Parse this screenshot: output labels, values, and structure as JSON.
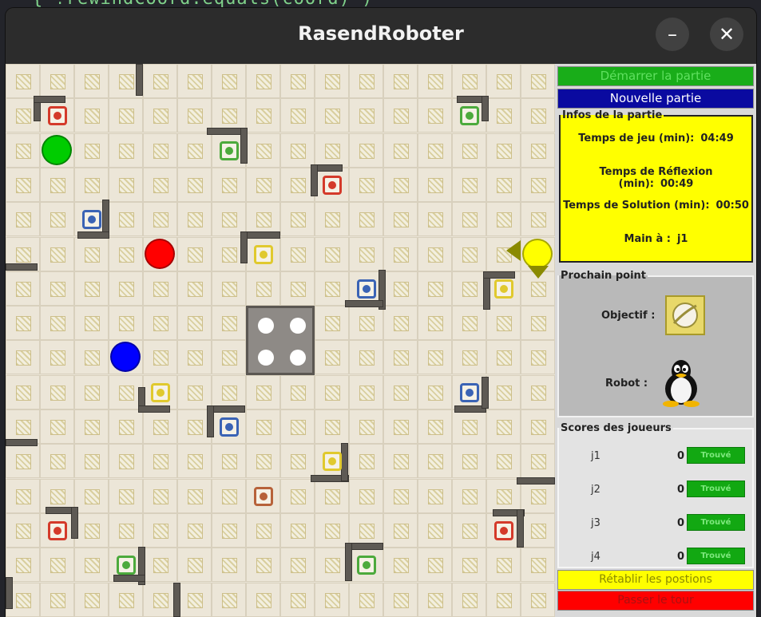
{
  "window": {
    "title": "RasendRoboter",
    "minimize_label": "–",
    "close_label": "✕"
  },
  "background_code": "{ !rewindCoord.equals(coord) ) ",
  "sidebar": {
    "start_label": "Démarrer la partie",
    "new_game_label": "Nouvelle partie",
    "infos": {
      "legend": "Infos de la partie",
      "rows": [
        {
          "label": "Temps de jeu (min):",
          "value": "04:49"
        },
        {
          "label": "Temps de Réflexion (min):",
          "value": "00:49"
        },
        {
          "label": "Temps de Solution (min):",
          "value": "00:50"
        },
        {
          "label": "Main à :",
          "value": "j1"
        }
      ]
    },
    "next_point": {
      "legend": "Prochain point",
      "objective_label": "Objectif :",
      "robot_label": "Robot :",
      "objective_icon": "yellow-planet-icon",
      "robot_icon": "penguin-icon"
    },
    "scores": {
      "legend": "Scores des joueurs",
      "players": [
        {
          "name": "j1",
          "score": "0",
          "button": "Trouvé"
        },
        {
          "name": "j2",
          "score": "0",
          "button": "Trouvé"
        },
        {
          "name": "j3",
          "score": "0",
          "button": "Trouvé"
        },
        {
          "name": "j4",
          "score": "0",
          "button": "Trouvé"
        }
      ]
    },
    "reset_label": "Rétablir les postions",
    "pass_label": "Passer le tour"
  },
  "board": {
    "rows": 16,
    "cols": 16,
    "robots": [
      {
        "color": "#00cc00",
        "row": 2,
        "col": 1
      },
      {
        "color": "#ff0000",
        "row": 5,
        "col": 4
      },
      {
        "color": "#0000ff",
        "row": 8,
        "col": 3
      },
      {
        "color": "#ffff00",
        "row": 5,
        "col": 15
      }
    ],
    "targets": [
      {
        "name": "red-triangle-target",
        "row": 1,
        "col": 1,
        "color": "#d43a2a"
      },
      {
        "name": "green-triangle-target",
        "row": 1,
        "col": 13,
        "color": "#4caa3c"
      },
      {
        "name": "green-planet-target",
        "row": 2,
        "col": 6,
        "color": "#4caa3c"
      },
      {
        "name": "red-planet-target",
        "row": 3,
        "col": 9,
        "color": "#d43a2a"
      },
      {
        "name": "blue-cross-target",
        "row": 4,
        "col": 2,
        "color": "#3a63b5"
      },
      {
        "name": "yellow-planet-target",
        "row": 5,
        "col": 7,
        "color": "#e0c92e"
      },
      {
        "name": "blue-square-target",
        "row": 6,
        "col": 10,
        "color": "#3a63b5"
      },
      {
        "name": "yellow-star-target",
        "row": 6,
        "col": 14,
        "color": "#e0c92e"
      },
      {
        "name": "yellow-triangle-target",
        "row": 9,
        "col": 4,
        "color": "#e0c92e"
      },
      {
        "name": "blue-triangle-target",
        "row": 9,
        "col": 13,
        "color": "#3a63b5"
      },
      {
        "name": "blue-planet-target",
        "row": 10,
        "col": 6,
        "color": "#3a63b5"
      },
      {
        "name": "yellow-moon-target",
        "row": 11,
        "col": 9,
        "color": "#e0c92e"
      },
      {
        "name": "vortex-target",
        "row": 12,
        "col": 7,
        "color": "#b7623a"
      },
      {
        "name": "red-cross-target",
        "row": 13,
        "col": 1,
        "color": "#d43a2a"
      },
      {
        "name": "red-square-target",
        "row": 13,
        "col": 14,
        "color": "#d43a2a"
      },
      {
        "name": "green-square-target",
        "row": 14,
        "col": 3,
        "color": "#4caa3c"
      },
      {
        "name": "green-cross-target",
        "row": 14,
        "col": 10,
        "color": "#4caa3c"
      }
    ],
    "yellow_robot_arrows": [
      "left",
      "down"
    ]
  }
}
